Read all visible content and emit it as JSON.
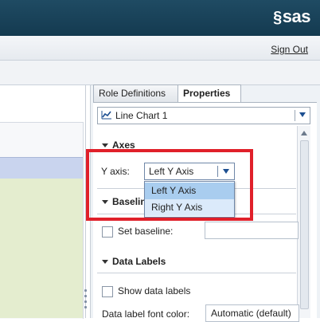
{
  "brand": {
    "logo_text": "sas"
  },
  "header": {
    "sign_out_label": "Sign Out"
  },
  "panel": {
    "tabs": [
      {
        "label": "Role Definitions",
        "active": false
      },
      {
        "label": "Properties",
        "active": true
      }
    ],
    "object_selector": {
      "value": "Line Chart 1",
      "icon": "line-chart-icon"
    },
    "sections": {
      "axes": {
        "title": "Axes",
        "y_axis_label": "Y axis:",
        "y_axis_value": "Left Y Axis",
        "y_axis_options": [
          "Left Y Axis",
          "Right Y Axis"
        ]
      },
      "baseline": {
        "title": "Baseline",
        "set_baseline_label": "Set baseline:",
        "set_baseline_checked": false,
        "baseline_value": ""
      },
      "data_labels": {
        "title": "Data Labels",
        "show_data_labels_label": "Show data labels",
        "show_data_labels_checked": false,
        "font_color_label": "Data label font color:",
        "font_color_value": "Automatic (default)"
      }
    }
  },
  "colors": {
    "header_bg": "#1a4459",
    "highlight_box": "#e0202a",
    "selected_option": "#a9cdef",
    "hover_option": "#dbeafa",
    "canvas_plot": "#e4edcf"
  }
}
